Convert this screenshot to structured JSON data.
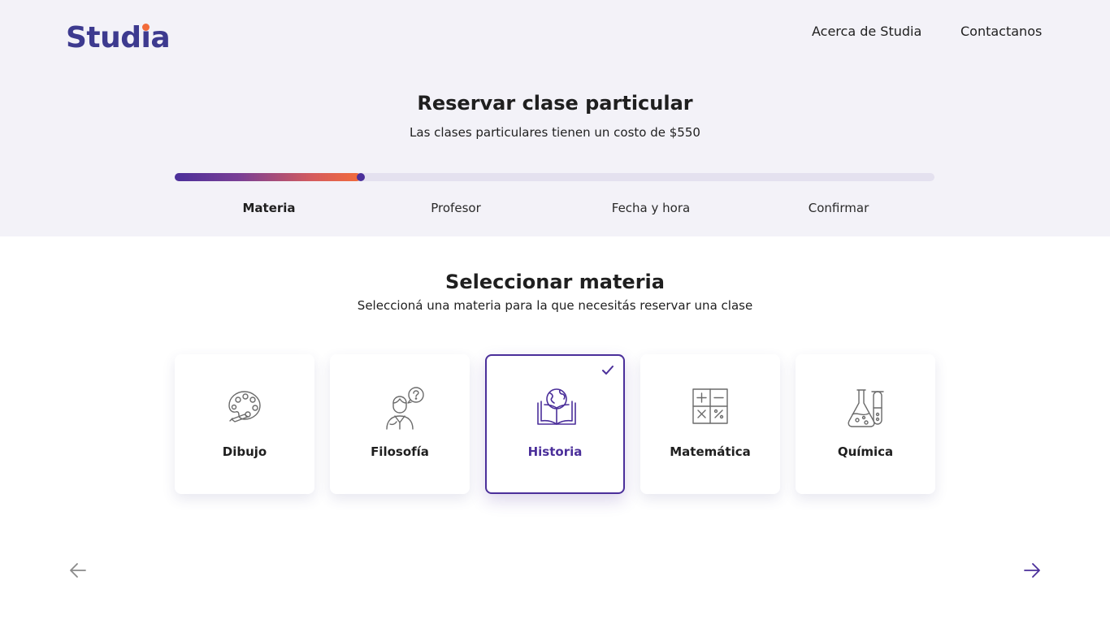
{
  "header": {
    "logo_text": "Studia",
    "nav": [
      {
        "label": "Acerca de Studia"
      },
      {
        "label": "Contactanos"
      }
    ]
  },
  "booking": {
    "title": "Reservar clase particular",
    "subtitle": "Las clases particulares tienen un costo de $550",
    "progress_fraction": 0.245,
    "steps": [
      {
        "label": "Materia",
        "active": true
      },
      {
        "label": "Profesor",
        "active": false
      },
      {
        "label": "Fecha y hora",
        "active": false
      },
      {
        "label": "Confirmar",
        "active": false
      }
    ]
  },
  "subject_selection": {
    "title": "Seleccionar materia",
    "subtitle": "Seleccioná una materia para la que necesitás reservar una clase",
    "subjects": [
      {
        "label": "Dibujo",
        "icon": "palette-icon",
        "selected": false
      },
      {
        "label": "Filosofía",
        "icon": "thinker-icon",
        "selected": false
      },
      {
        "label": "Historia",
        "icon": "globe-book-icon",
        "selected": true
      },
      {
        "label": "Matemática",
        "icon": "math-operators-icon",
        "selected": false
      },
      {
        "label": "Química",
        "icon": "flasks-icon",
        "selected": false
      }
    ]
  },
  "navigation": {
    "prev_icon": "arrow-left-icon",
    "next_icon": "arrow-right-icon"
  },
  "colors": {
    "brand": "#3d3a8f",
    "accent": "#f26b3a",
    "selected": "#4b2f9a",
    "header_bg": "#f3f2f8"
  }
}
